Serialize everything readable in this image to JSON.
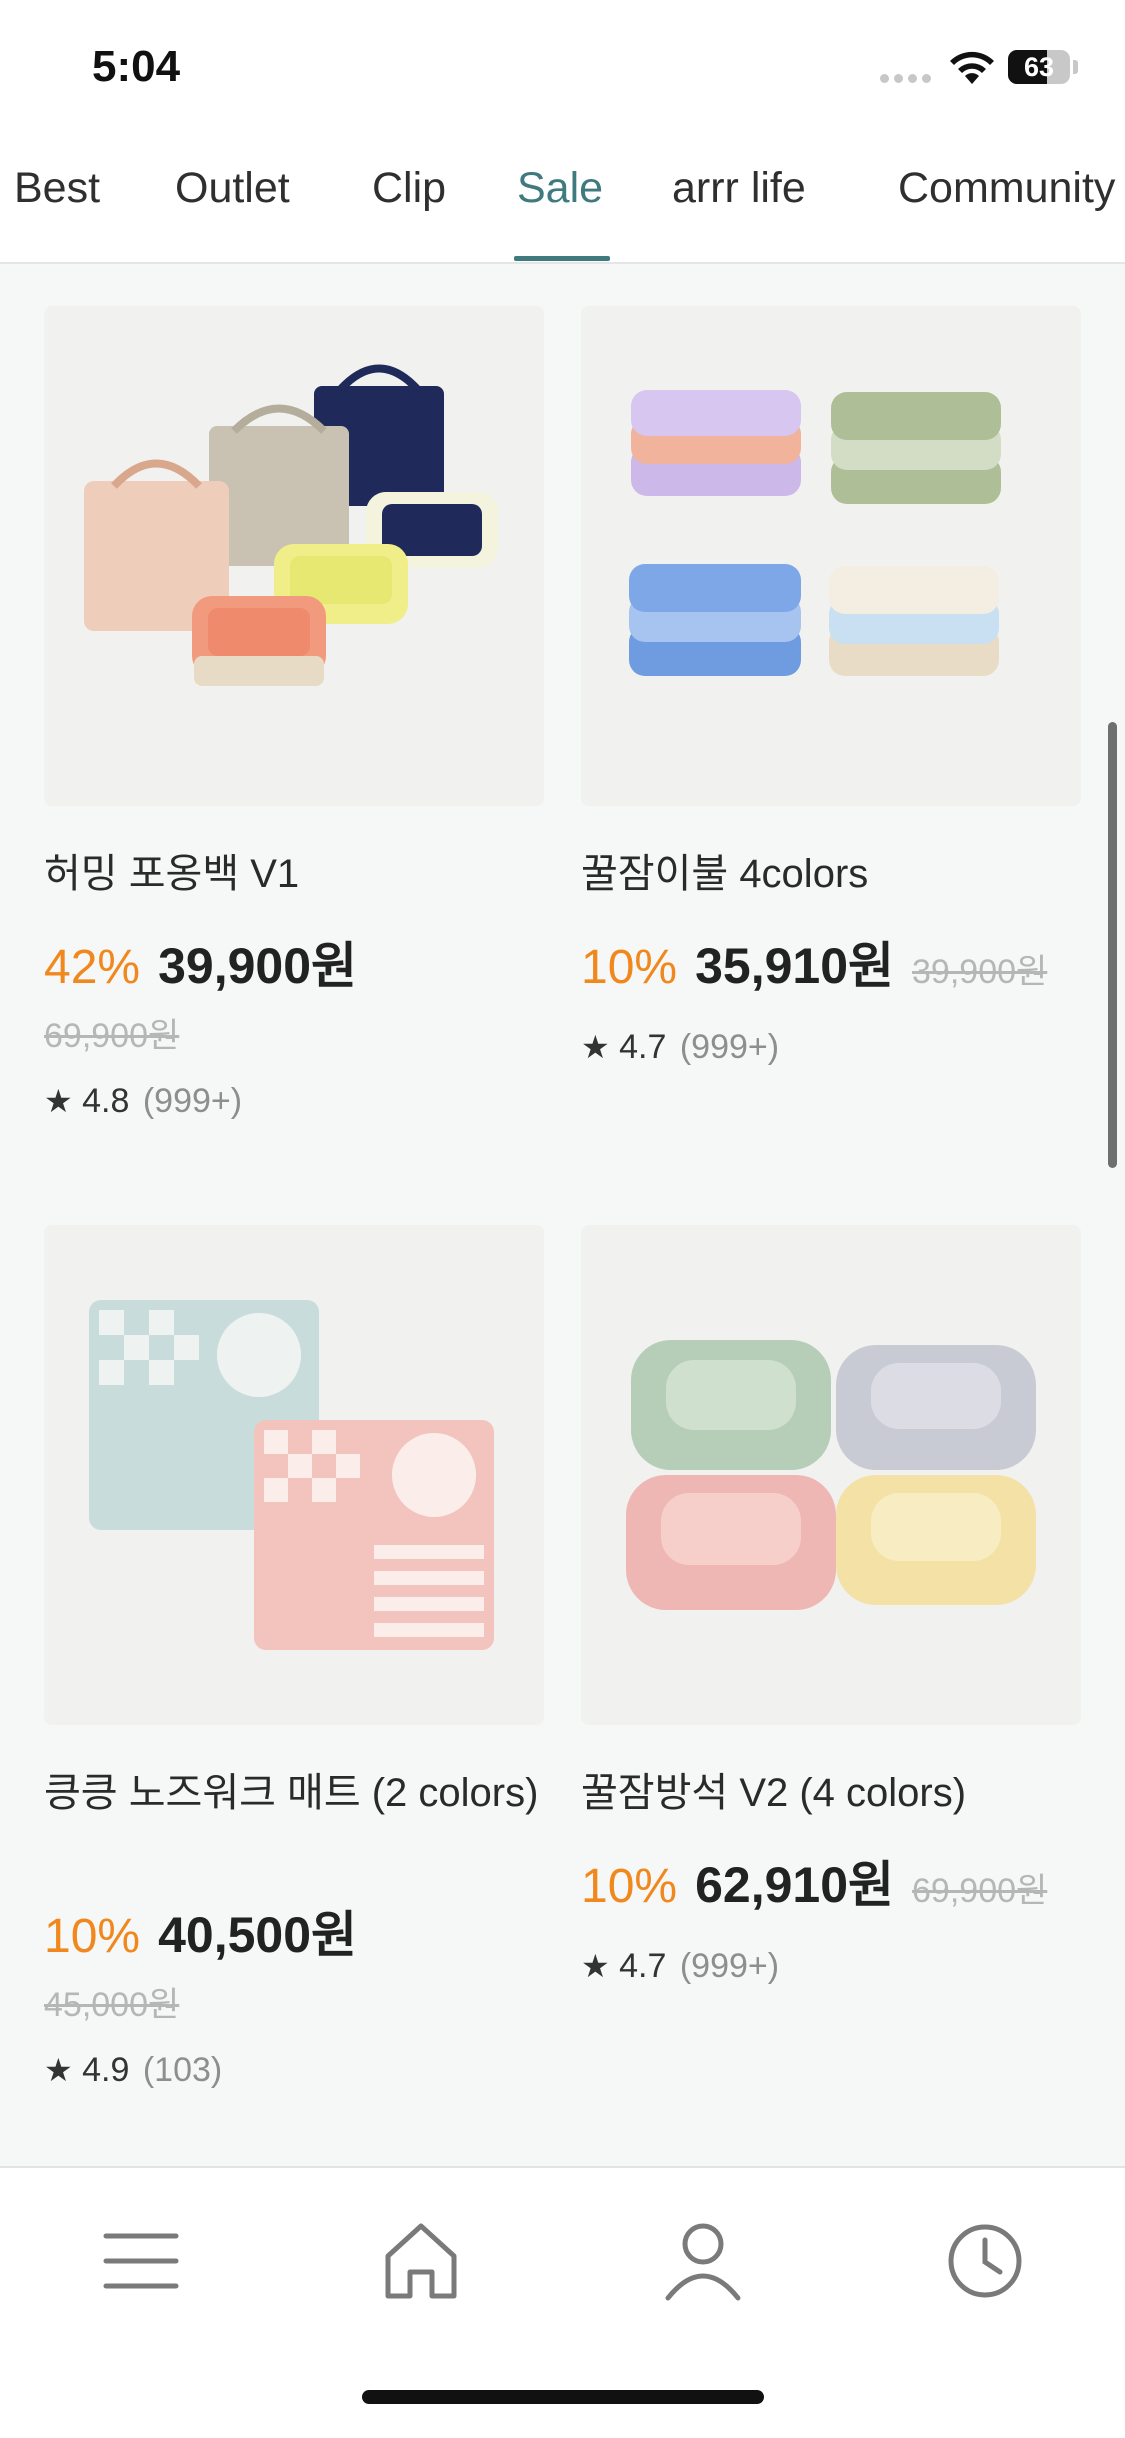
{
  "status_bar": {
    "time": "5:04",
    "battery": "63",
    "battery_level": 0.63
  },
  "tabs": [
    {
      "label": "Best",
      "active": false
    },
    {
      "label": "Outlet",
      "active": false
    },
    {
      "label": "Clip",
      "active": false
    },
    {
      "label": "Sale",
      "active": true
    },
    {
      "label": "arrr life",
      "active": false
    },
    {
      "label": "Community",
      "active": false
    }
  ],
  "products": [
    {
      "name": "허밍 포옹백 V1",
      "discount": "42%",
      "price": "39,900원",
      "original_price": "69,900원",
      "rating": "4.8",
      "reviews": "(999+)"
    },
    {
      "name": "꿀잠이불 4colors",
      "discount": "10%",
      "price": "35,910원",
      "original_price": "39,900원",
      "rating": "4.7",
      "reviews": "(999+)"
    },
    {
      "name": "킁킁 노즈워크 매트 (2 colors)",
      "discount": "10%",
      "price": "40,500원",
      "original_price": "45,000원",
      "rating": "4.9",
      "reviews": "(103)"
    },
    {
      "name": "꿀잠방석 V2 (4 colors)",
      "discount": "10%",
      "price": "62,910원",
      "original_price": "69,900원",
      "rating": "4.7",
      "reviews": "(999+)"
    }
  ],
  "rating_star": "★",
  "bottom_nav": [
    {
      "icon": "menu-icon"
    },
    {
      "icon": "home-icon"
    },
    {
      "icon": "profile-icon"
    },
    {
      "icon": "history-clock-icon"
    }
  ],
  "colors": {
    "accent": "#3f7a7f",
    "discount": "#f0881e"
  }
}
